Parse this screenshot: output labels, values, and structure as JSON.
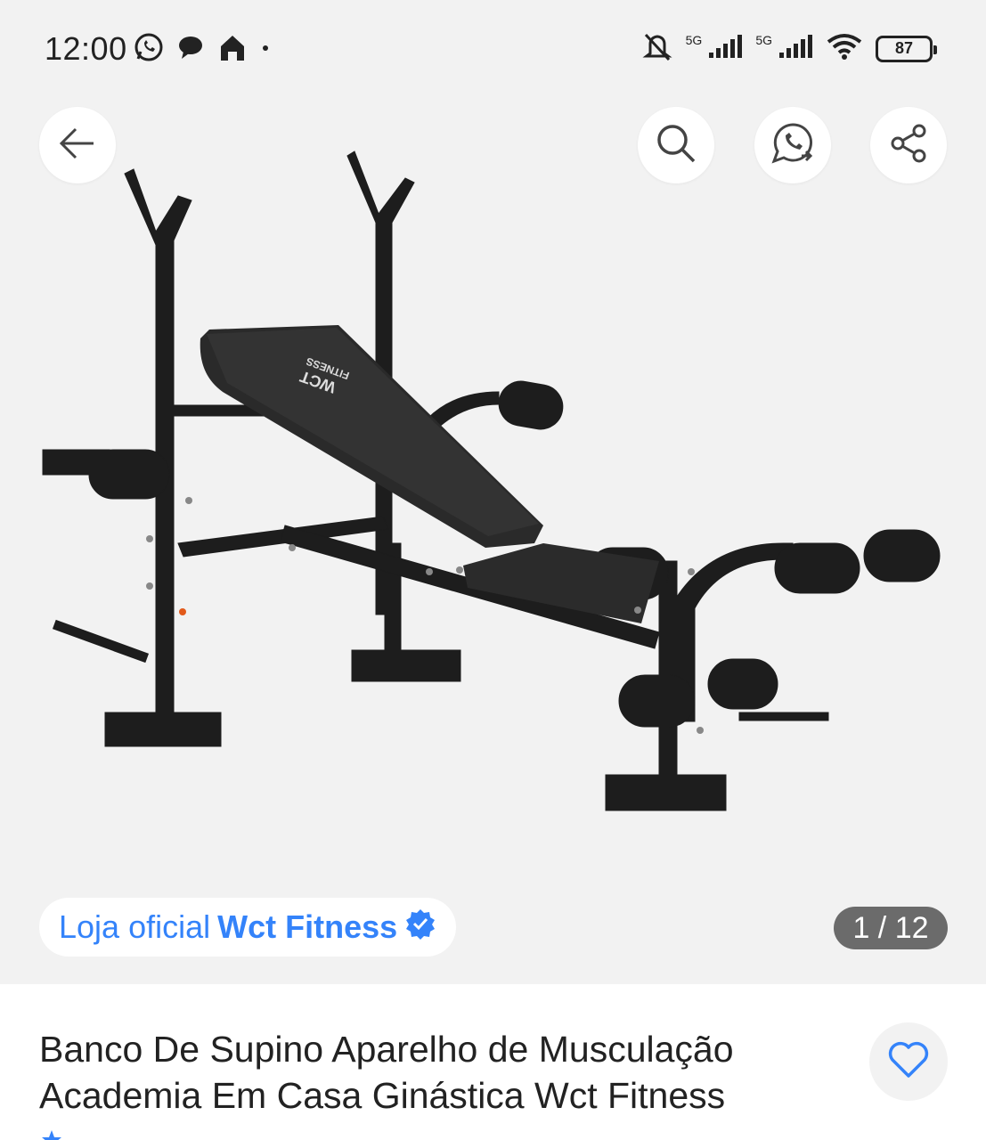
{
  "status_bar": {
    "time": "12:00",
    "net1": "5G",
    "net2": "5G",
    "battery": "87",
    "left_icons": [
      "whatsapp-icon",
      "chat-bubble-icon",
      "home-icon",
      "dot-icon"
    ],
    "right_icons": [
      "bell-off-icon",
      "signal-icon",
      "signal-icon",
      "wifi-icon",
      "battery-icon"
    ]
  },
  "toolbar": {
    "icons": [
      "back-arrow-icon",
      "search-icon",
      "whatsapp-share-icon",
      "share-icon"
    ]
  },
  "gallery": {
    "store_prefix": "Loja oficial",
    "store_name": "Wct Fitness",
    "counter": "1 / 12",
    "verified_icon": "verified-badge-icon",
    "bench_logo_line1": "WCT",
    "bench_logo_line2": "FITNESS"
  },
  "product": {
    "title": "Banco De Supino Aparelho de Musculação Academia Em Casa Ginástica Wct Fitness",
    "favorite_icon": "heart-icon"
  },
  "colors": {
    "accent": "#3483fa",
    "gallery_bg": "#f2f2f2",
    "counter_bg": "#6b6b6b"
  }
}
